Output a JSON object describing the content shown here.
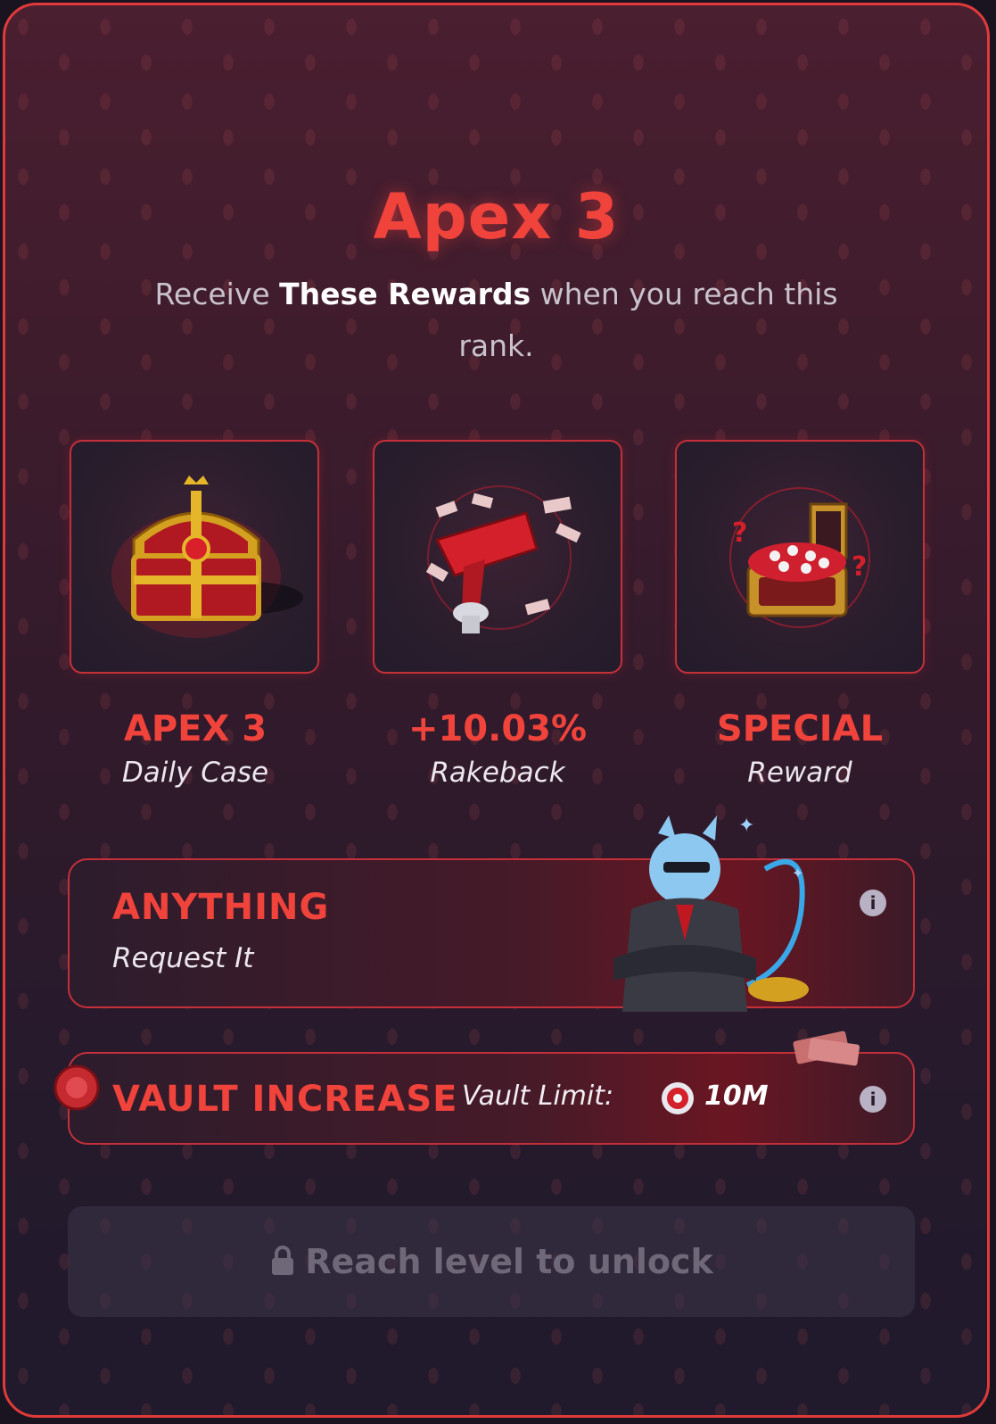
{
  "rank": {
    "title": "Apex 3",
    "subtitle_pre": "Receive ",
    "subtitle_bold": "These Rewards",
    "subtitle_post": " when you reach this rank."
  },
  "rewards": [
    {
      "title": "APEX 3",
      "subtitle": "Daily Case",
      "icon": "treasure-chest-icon"
    },
    {
      "title": "+10.03%",
      "subtitle": "Rakeback",
      "icon": "money-gun-icon"
    },
    {
      "title": "SPECIAL",
      "subtitle": "Reward",
      "icon": "mystery-chest-icon"
    }
  ],
  "perks": {
    "anything": {
      "title": "ANYTHING",
      "subtitle": "Request It",
      "info_icon": "info-icon"
    },
    "vault": {
      "title": "VAULT INCREASE",
      "limit_label": "Vault Limit:",
      "limit_value": "10M",
      "info_icon": "info-icon"
    }
  },
  "unlock": {
    "label": "Reach level to unlock",
    "icon": "lock-icon"
  },
  "colors": {
    "accent": "#f0433c",
    "border": "#e03a3a"
  }
}
